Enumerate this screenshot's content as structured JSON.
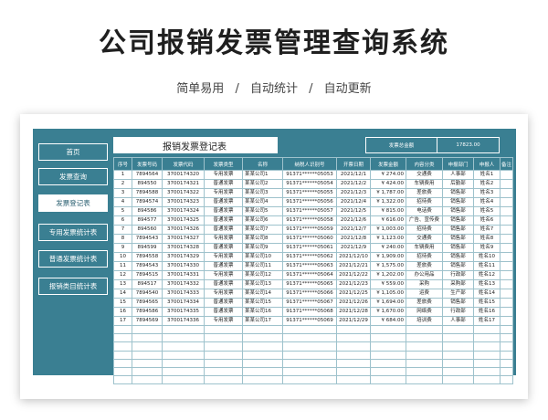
{
  "banner": {
    "title": "公司报销发票管理查询系统",
    "features": [
      "简单易用",
      "自动统计",
      "自动更新"
    ],
    "separator": "/"
  },
  "app": {
    "nav": [
      {
        "label": "首页",
        "active": false
      },
      {
        "label": "发票查询",
        "active": false
      },
      {
        "label": "发票登记表",
        "active": true
      },
      {
        "label": "专用发票统计表",
        "active": false
      },
      {
        "label": "普通发票统计表",
        "active": false
      },
      {
        "label": "报销类目统计表",
        "active": false
      }
    ],
    "form_title": "报销发票登记表",
    "summary": {
      "label": "发票总金额",
      "value": "17823.00"
    },
    "columns": [
      "序号",
      "发票号码",
      "发票代码",
      "发票类型",
      "名称",
      "纳税人识别号",
      "开票日期",
      "发票金额",
      "内容分类",
      "申报部门",
      "申报人",
      "备注"
    ],
    "rows": [
      [
        "1",
        "7894564",
        "3700174320",
        "专用发票",
        "某某公司1",
        "91371******05053",
        "2021/12/1",
        "¥ 274.00",
        "交通费",
        "人事部",
        "姓名1",
        ""
      ],
      [
        "2",
        "894550",
        "3700174321",
        "普通发票",
        "某某公司2",
        "91371******05054",
        "2021/12/2",
        "¥ 424.00",
        "车辆费用",
        "后勤部",
        "姓名2",
        ""
      ],
      [
        "3",
        "7894588",
        "3700174322",
        "专用发票",
        "某某公司3",
        "91371******05055",
        "2021/12/3",
        "¥ 1,787.00",
        "差旅费",
        "销售部",
        "姓名3",
        ""
      ],
      [
        "4",
        "7894574",
        "3700174323",
        "普通发票",
        "某某公司4",
        "91371******05056",
        "2021/12/4",
        "¥ 1,322.00",
        "招待费",
        "销售部",
        "姓名4",
        ""
      ],
      [
        "5",
        "894586",
        "3700174324",
        "普通发票",
        "某某公司5",
        "91371******05057",
        "2021/12/5",
        "¥ 815.00",
        "电话费",
        "销售部",
        "姓名5",
        ""
      ],
      [
        "6",
        "894577",
        "3700174325",
        "普通发票",
        "某某公司6",
        "91371******05058",
        "2021/12/6",
        "¥ 616.00",
        "广告、宣传费",
        "销售部",
        "姓名6",
        ""
      ],
      [
        "7",
        "894560",
        "3700174326",
        "普通发票",
        "某某公司7",
        "91371******05059",
        "2021/12/7",
        "¥ 1,003.00",
        "招待费",
        "销售部",
        "姓名7",
        ""
      ],
      [
        "8",
        "7894543",
        "3700174327",
        "专用发票",
        "某某公司8",
        "91371******05060",
        "2021/12/8",
        "¥ 1,123.00",
        "交通费",
        "销售部",
        "姓名8",
        ""
      ],
      [
        "9",
        "894599",
        "3700174328",
        "普通发票",
        "某某公司9",
        "91371******05061",
        "2021/12/9",
        "¥ 240.00",
        "车辆费用",
        "销售部",
        "姓名9",
        ""
      ],
      [
        "10",
        "7894558",
        "3700174329",
        "专用发票",
        "某某公司10",
        "91371******05062",
        "2021/12/10",
        "¥ 1,909.00",
        "招待费",
        "销售部",
        "姓名10",
        ""
      ],
      [
        "11",
        "7894543",
        "3700174330",
        "普通发票",
        "某某公司11",
        "91371******05063",
        "2021/12/21",
        "¥ 1,575.00",
        "差旅费",
        "销售部",
        "姓名11",
        ""
      ],
      [
        "12",
        "7894515",
        "3700174331",
        "专用发票",
        "某某公司12",
        "91371******05064",
        "2021/12/22",
        "¥ 1,202.00",
        "办公用品",
        "行政部",
        "姓名12",
        ""
      ],
      [
        "13",
        "894517",
        "3700174332",
        "普通发票",
        "某某公司13",
        "91371******05065",
        "2021/12/23",
        "¥ 559.00",
        "采购",
        "采购部",
        "姓名13",
        ""
      ],
      [
        "14",
        "7894540",
        "3700174333",
        "专用发票",
        "某某公司14",
        "91371******05066",
        "2021/12/25",
        "¥ 1,105.00",
        "运费",
        "生产部",
        "姓名14",
        ""
      ],
      [
        "15",
        "7894565",
        "3700174334",
        "普通发票",
        "某某公司15",
        "91371******05067",
        "2021/12/26",
        "¥ 1,694.00",
        "差旅费",
        "销售部",
        "姓名15",
        ""
      ],
      [
        "16",
        "7894586",
        "3700174335",
        "普通发票",
        "某某公司16",
        "91371******05068",
        "2021/12/28",
        "¥ 1,670.00",
        "网络费",
        "行政部",
        "姓名16",
        ""
      ],
      [
        "17",
        "7894569",
        "3700174336",
        "专用发票",
        "某某公司17",
        "91371******05069",
        "2021/12/29",
        "¥ 684.00",
        "培训费",
        "人事部",
        "姓名17",
        ""
      ]
    ],
    "empty_rows": 7,
    "colors": {
      "panel": "#3a7f92",
      "grid_line": "#9ec2cc"
    }
  }
}
